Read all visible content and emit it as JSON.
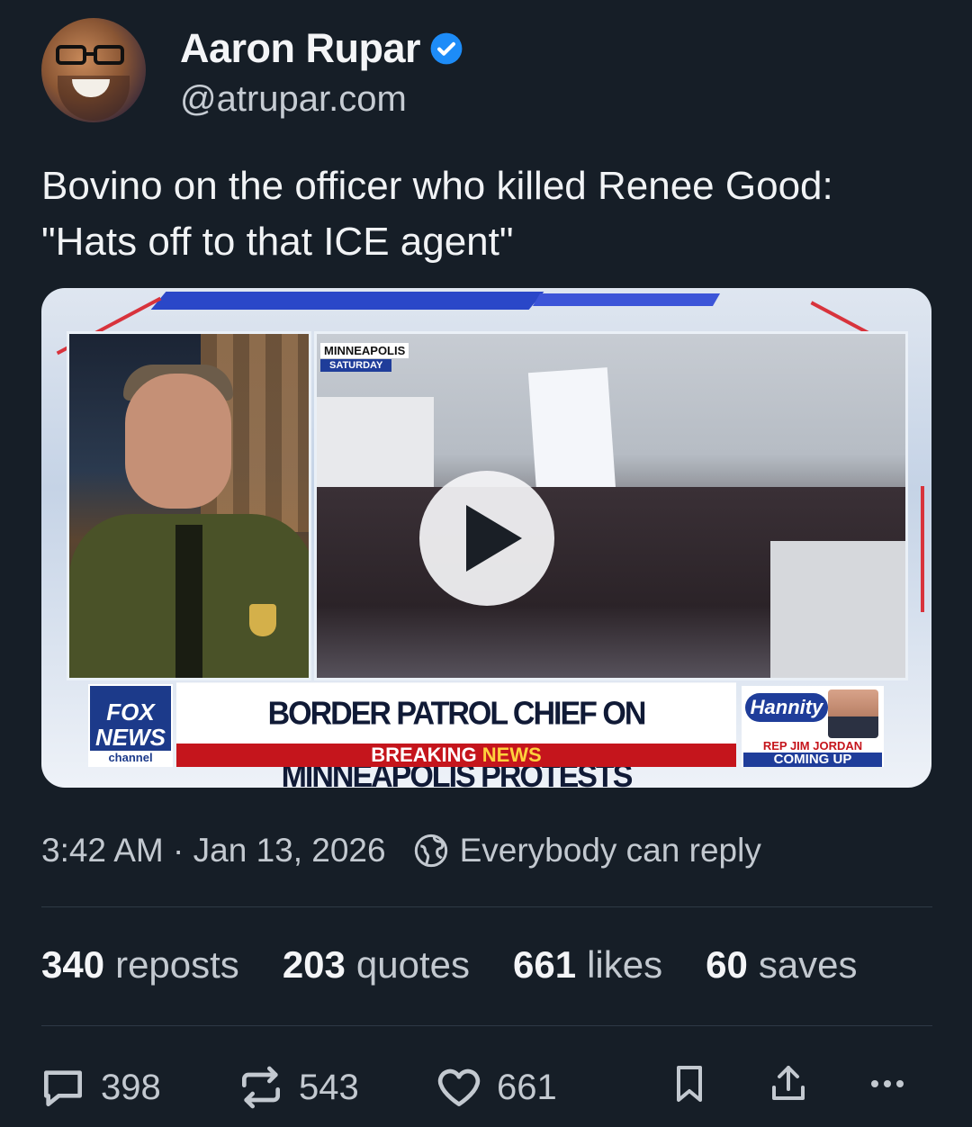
{
  "author": {
    "name": "Aaron Rupar",
    "handle": "@atrupar.com",
    "verified": true
  },
  "post": {
    "text": "Bovino on the officer who killed Renee Good: \"Hats off to that ICE agent\""
  },
  "media": {
    "type": "video",
    "location_label": "MINNEAPOLIS",
    "location_sub": "SATURDAY",
    "network_l1": "FOX",
    "network_l2": "NEWS",
    "network_l3": "channel",
    "headline": "BORDER PATROL CHIEF ON MINNEAPOLIS PROTESTS",
    "breaking_1": "BREAKING ",
    "breaking_2": "NEWS",
    "promo_show": "Hannity",
    "promo_guest": "REP JIM JORDAN",
    "promo_coming": "COMING UP"
  },
  "meta": {
    "timestamp": "3:42 AM · Jan 13, 2026",
    "reply_setting": "Everybody can reply"
  },
  "stats": {
    "reposts_count": "340",
    "reposts_label": "reposts",
    "quotes_count": "203",
    "quotes_label": "quotes",
    "likes_count": "661",
    "likes_label": "likes",
    "saves_count": "60",
    "saves_label": "saves"
  },
  "actions": {
    "replies": "398",
    "reposts": "543",
    "likes": "661"
  },
  "colors": {
    "background": "#161e27",
    "verified": "#1d8cf8",
    "text_primary": "#f1f3f5",
    "text_secondary": "#c3c9d0"
  }
}
